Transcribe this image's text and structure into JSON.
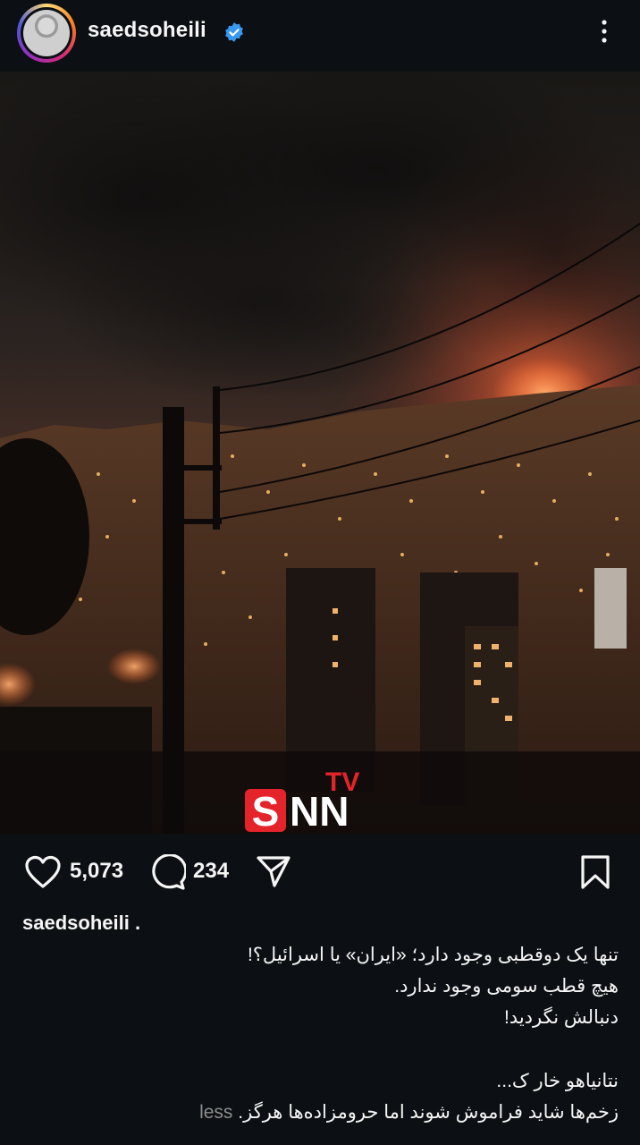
{
  "header": {
    "username": "saedsoheili",
    "verified": true,
    "avatar_icon": "profile-photo",
    "menu_icon": "more-vertical-icon"
  },
  "post": {
    "image_description_icon": "city-fire-night-photo",
    "watermark": {
      "main": "SNN",
      "sup": "TV"
    }
  },
  "actions": {
    "likes": "5,073",
    "comments": "234"
  },
  "caption": {
    "username": "saedsoheili",
    "username_suffix": ".",
    "lines": [
      "تنها یک دوقطبی وجود دارد؛ «ایران» یا اسرائیل؟!",
      "هیچ قطب سومی وجود ندارد.",
      "دنبالش نگردید!",
      "",
      "نتانیاهو خار ک...",
      "زخم‌ها شاید فراموش شوند اما حرومزاده‌ها هرگز."
    ],
    "less_label": "less"
  },
  "colors": {
    "background": "#0c0f14",
    "verified_blue": "#3897f0",
    "less_gray": "#8e8e8e",
    "watermark_red": "#e4232b"
  }
}
